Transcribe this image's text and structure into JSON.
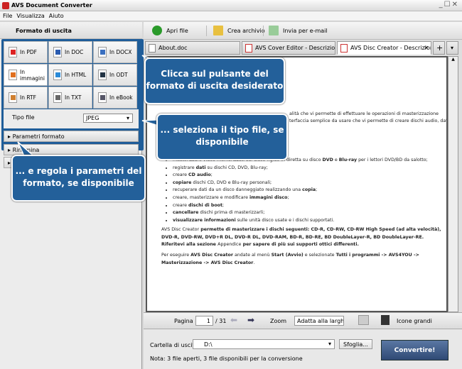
{
  "window": {
    "title": "AVS Document Converter",
    "controls": "_☐✕"
  },
  "menu": [
    "File",
    "Visualizza",
    "Aiuto"
  ],
  "left": {
    "header": "Formato di uscita",
    "formats": [
      {
        "label": "In PDF",
        "color": "#d22"
      },
      {
        "label": "In DOC",
        "color": "#2a5bb0"
      },
      {
        "label": "In DOCX",
        "color": "#3a6fc0"
      },
      {
        "label": "In immagini",
        "color": "#e07020"
      },
      {
        "label": "In HTML",
        "color": "#2a8ad8"
      },
      {
        "label": "In ODT",
        "color": "#234"
      },
      {
        "label": "In RTF",
        "color": "#d08030"
      },
      {
        "label": "In TXT",
        "color": "#666"
      },
      {
        "label": "In eBook",
        "color": "#556"
      }
    ],
    "tipo_label": "Tipo file",
    "tipo_value": "JPEG",
    "accordion": [
      "Parametri formato",
      "Rinomina",
      ""
    ]
  },
  "toolbar": {
    "open": "Apri file",
    "archive": "Crea archivio",
    "email": "Invia per e-mail"
  },
  "tabs": [
    "About.doc",
    "AVS Cover Editor - Descrizione.pdf",
    "AVS Disc Creator - Descrizione..."
  ],
  "document": {
    "partial": [
      "alità che vi permette di effettuare le operazioni di masterizzazione",
      "terfaccia semplice da usare che vi permette di creare dischi audio, dati"
    ],
    "bullets": [
      [
        "masterizzare video memorizzati sul disco rigido in diretta su disco ",
        "DVD",
        " e ",
        "Blu-ray",
        " per i lettori DVD/BD da salotto;"
      ],
      [
        "registrare ",
        "dati",
        " su dischi CD, DVD, Blu-ray;"
      ],
      [
        "creare ",
        "CD audio",
        ";"
      ],
      [
        "",
        "copiare",
        " dischi CD, DVD e Blu-ray personali;"
      ],
      [
        "recuperare dati da un disco danneggiato realizzando una ",
        "copia",
        ";"
      ],
      [
        "creare, masterizzare e modificare ",
        "immagini disco",
        ";"
      ],
      [
        "creare ",
        "dischi di boot",
        ";"
      ],
      [
        "",
        "cancellare",
        " dischi prima di masterizzarli;"
      ],
      [
        "",
        "visualizzare informazioni",
        " sulle unità disco usate e i dischi supportati."
      ]
    ],
    "para1": [
      "AVS Disc Creator",
      " permette di masterizzare i dischi seguenti: CD-R, CD-RW, CD-RW High Speed (ad alta velocità), DVD-R, DVD-RW, DVD+R DL, DVD-R DL, DVD-RAM, BD-R, BD-RE, BD DoubleLayer-R, BD DoubleLayer-RE. Riferitevi alla sezione ",
      "Appendice",
      " per sapere di più sui supporti ottici differenti."
    ],
    "para2": [
      "Per eseguire ",
      "AVS Disc Creator",
      " andate al menù ",
      "Start (Avvio)",
      " e selezionate ",
      "Tutti i programmi -> AVS4YOU -> Masterizzazione -> AVS Disc Creator",
      "."
    ]
  },
  "nav": {
    "page_label": "Pagina",
    "page": "1",
    "total": "/ 31",
    "zoom_label": "Zoom",
    "zoom_value": "Adatta alla larghe:",
    "icons_label": "Icone grandi"
  },
  "bottom": {
    "folder_label": "Cartella di uscita:",
    "folder_value": "D:\\",
    "browse": "Sfoglia...",
    "note": "Nota: 3 file aperti, 3 file disponibili per la conversione",
    "convert": "Convertire!"
  },
  "callouts": [
    "Clicca sul pulsante del formato di uscita desiderato",
    "... seleziona il tipo file, se disponibile",
    "... e regola i parametri del formato, se disponibile"
  ]
}
